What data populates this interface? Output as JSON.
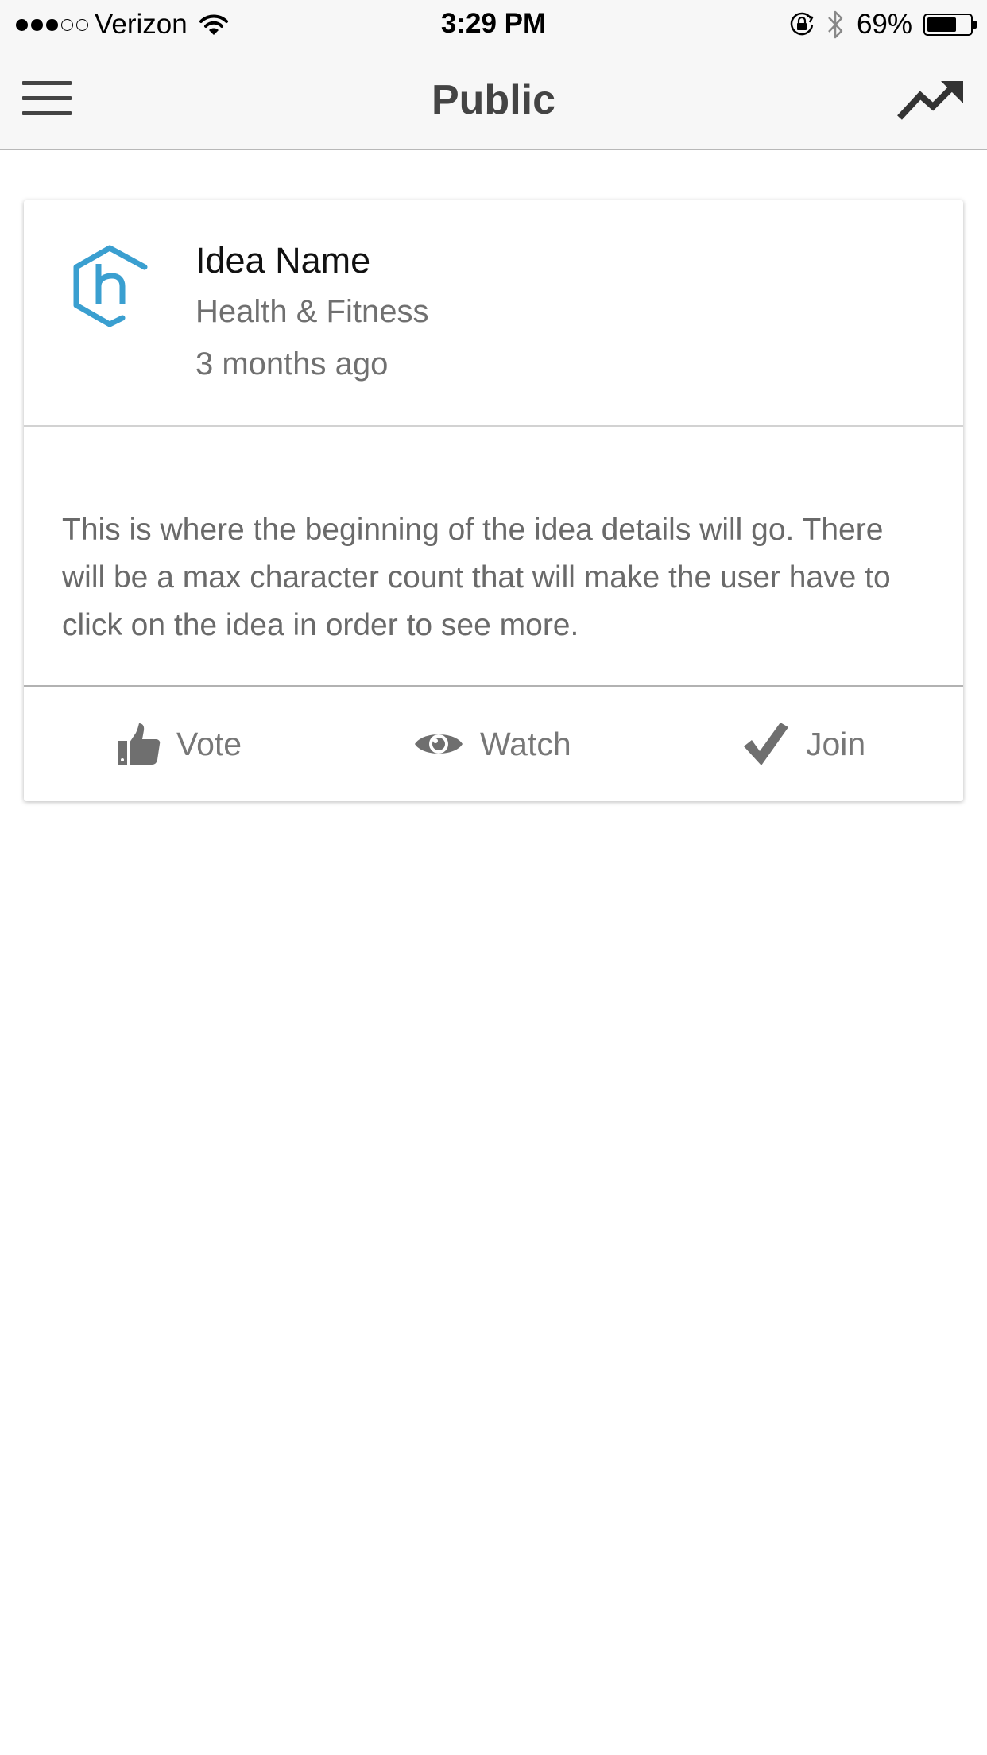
{
  "status_bar": {
    "carrier": "Verizon",
    "signal_bars_filled": 3,
    "signal_bars_total": 5,
    "time": "3:29 PM",
    "battery_percent": "69%",
    "battery_level": 0.69,
    "icons": [
      "wifi-icon",
      "orientation-lock-icon",
      "bluetooth-icon",
      "battery-icon"
    ]
  },
  "nav": {
    "title": "Public",
    "left_icon": "hamburger-menu-icon",
    "right_icon": "trending-icon"
  },
  "idea": {
    "name": "Idea Name",
    "category": "Health & Fitness",
    "time_ago": "3 months ago",
    "details": "This is where the beginning of the idea details will go. There will be a max character count that will make the user have to click on the idea in order to see more.",
    "logo_color": "#3a9fd0"
  },
  "actions": {
    "vote": "Vote",
    "watch": "Watch",
    "join": "Join"
  }
}
